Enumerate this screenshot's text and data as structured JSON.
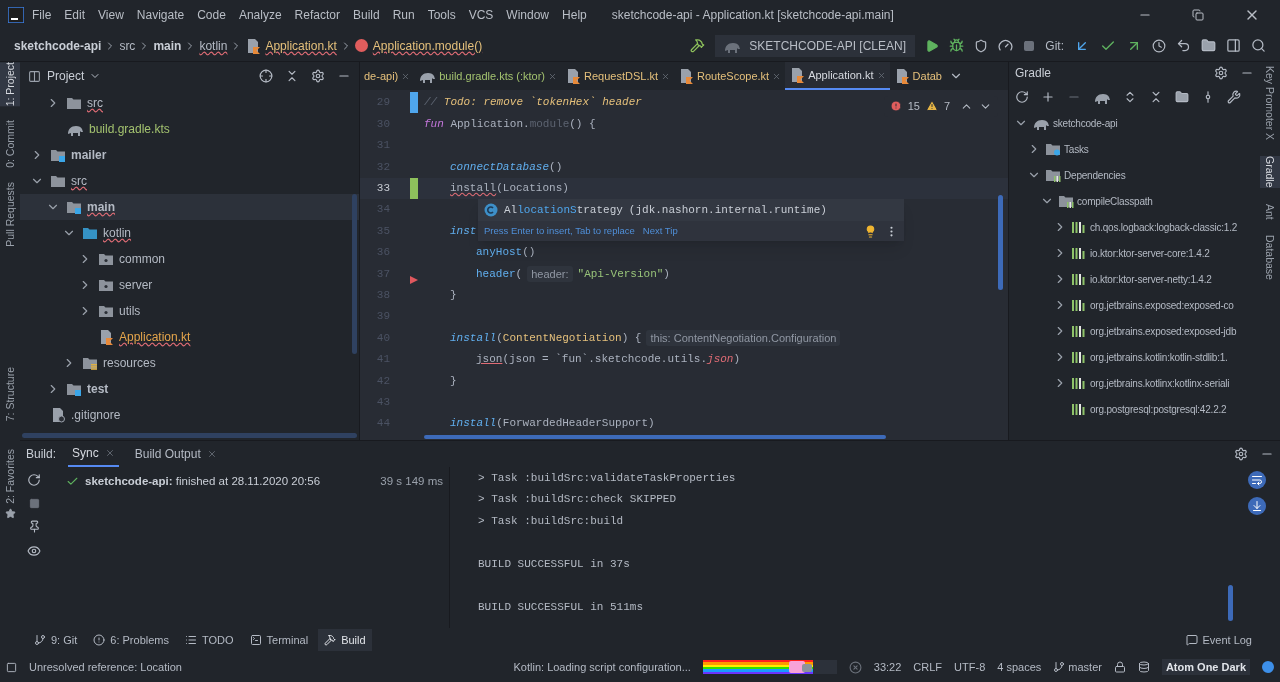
{
  "menu": [
    "File",
    "Edit",
    "View",
    "Navigate",
    "Code",
    "Analyze",
    "Refactor",
    "Build",
    "Run",
    "Tools",
    "VCS",
    "Window",
    "Help"
  ],
  "window": {
    "title": "sketchcode-api - Application.kt [sketchcode-api.main]"
  },
  "breadcrumbs": [
    {
      "label": "sketchcode-api",
      "kind": "project",
      "error": false
    },
    {
      "label": "src",
      "kind": "dir",
      "error": false
    },
    {
      "label": "main",
      "kind": "dir",
      "error": false
    },
    {
      "label": "kotlin",
      "kind": "dir",
      "error": true
    },
    {
      "label": "Application.kt",
      "kind": "file",
      "error": true
    },
    {
      "label": "Application.module()",
      "kind": "function",
      "error": true
    }
  ],
  "run_config": "SKETCHCODE-API [CLEAN]",
  "git_label": "Git:",
  "left_strip": [
    {
      "label": "1: Project",
      "selected": true
    },
    {
      "label": "0: Commit",
      "selected": false
    },
    {
      "label": "Pull Requests",
      "selected": false
    }
  ],
  "left_strip_bottom": [
    {
      "label": "7: Structure",
      "selected": false
    },
    {
      "label": "2: Favorites",
      "selected": false
    }
  ],
  "project": {
    "title": "Project",
    "tree": [
      {
        "children": [
          {
            "label": "src",
            "kind": "folder",
            "expanded": false,
            "error": true,
            "selected": false
          },
          {
            "label": "build.gradle.kts",
            "kind": "gradle",
            "color": "#a3c26f",
            "error": false,
            "selected": false
          }
        ]
      },
      {
        "label": "mailer",
        "kind": "module",
        "expanded": false,
        "error": false,
        "selected": false
      },
      {
        "label": "src",
        "kind": "folder",
        "expanded": true,
        "error": true,
        "selected": false,
        "children": [
          {
            "label": "main",
            "kind": "module",
            "expanded": true,
            "error": true,
            "selected": true,
            "children": [
              {
                "label": "kotlin",
                "kind": "source",
                "expanded": true,
                "error": true,
                "selected": false,
                "children": [
                  {
                    "label": "common",
                    "kind": "package",
                    "expanded": false,
                    "error": false,
                    "selected": false
                  },
                  {
                    "label": "server",
                    "kind": "package",
                    "expanded": false,
                    "error": false,
                    "selected": false
                  },
                  {
                    "label": "utils",
                    "kind": "package",
                    "expanded": false,
                    "error": false,
                    "selected": false
                  },
                  {
                    "label": "Application.kt",
                    "kind": "kotlin",
                    "color": "#e5a54b",
                    "error": true,
                    "selected": false
                  }
                ]
              },
              {
                "label": "resources",
                "kind": "resources",
                "expanded": false,
                "error": false,
                "selected": false
              }
            ]
          },
          {
            "label": "test",
            "kind": "module",
            "expanded": false,
            "error": false,
            "selected": false
          }
        ]
      },
      {
        "label": ".gitignore",
        "kind": "ignore",
        "error": false,
        "selected": false
      }
    ]
  },
  "editor": {
    "tabs": [
      {
        "label": "de-api)",
        "kind": "kotlin",
        "selected": false
      },
      {
        "label": "build.gradle.kts (:ktor)",
        "kind": "gradle",
        "selected": false
      },
      {
        "label": "RequestDSL.kt",
        "kind": "kotlin",
        "selected": false
      },
      {
        "label": "RouteScope.kt",
        "kind": "kotlin",
        "selected": false
      },
      {
        "label": "Application.kt",
        "kind": "kotlin",
        "selected": true
      },
      {
        "label": "Datab",
        "kind": "kotlin",
        "selected": false
      }
    ],
    "errors": "15",
    "warnings": "7",
    "lines": [
      {
        "number": "29",
        "current": false,
        "modified": true,
        "added": false,
        "flagged": false,
        "tokens": [
          {
            "kind": "comment",
            "t": "//"
          },
          {
            "kind": "todo",
            "t": " Todo: remove `tokenHex` header"
          }
        ]
      },
      {
        "number": "30",
        "current": false,
        "modified": false,
        "added": false,
        "flagged": false,
        "tokens": [
          {
            "kind": "keyword",
            "t": "fun"
          },
          {
            "kind": "plain",
            "t": " Application."
          },
          {
            "kind": "muted",
            "t": "module"
          },
          {
            "kind": "plain",
            "t": "() {"
          }
        ],
        "children": [
          {
            "number": "31",
            "current": false,
            "modified": false,
            "added": false,
            "flagged": false
          },
          {
            "number": "32",
            "current": false,
            "modified": false,
            "added": false,
            "flagged": false,
            "tokens": [
              {
                "kind": "call",
                "t": "connectDatabase"
              },
              {
                "kind": "plain",
                "t": "()"
              }
            ]
          },
          {
            "number": "33",
            "current": true,
            "modified": false,
            "added": true,
            "flagged": false,
            "tokens": [
              {
                "kind": "error",
                "t": "install"
              },
              {
                "kind": "plain",
                "t": "(Locations)"
              }
            ]
          },
          {
            "number": "34",
            "current": false,
            "modified": false,
            "added": false,
            "flagged": false
          },
          {
            "number": "35",
            "current": false,
            "modified": false,
            "added": false,
            "flagged": false,
            "tokens": [
              {
                "kind": "call",
                "t": "inst"
              }
            ],
            "children": [
              {
                "number": "36",
                "current": false,
                "modified": false,
                "added": false,
                "flagged": false,
                "tokens": [
                  {
                    "kind": "fn",
                    "t": "anyHost"
                  },
                  {
                    "kind": "plain",
                    "t": "()"
                  }
                ]
              },
              {
                "number": "37",
                "current": false,
                "modified": false,
                "added": false,
                "flagged": true,
                "tokens": [
                  {
                    "kind": "fn",
                    "t": "header"
                  },
                  {
                    "kind": "plain",
                    "t": "("
                  },
                  {
                    "kind": "hint",
                    "t": "header:"
                  },
                  {
                    "kind": "string",
                    "t": "\"Api-Version\""
                  },
                  {
                    "kind": "plain",
                    "t": ")"
                  }
                ]
              }
            ]
          },
          {
            "number": "38",
            "current": false,
            "modified": false,
            "added": false,
            "flagged": false,
            "tokens": [
              {
                "kind": "plain",
                "t": "}"
              }
            ]
          },
          {
            "number": "39",
            "current": false,
            "modified": false,
            "added": false,
            "flagged": false
          },
          {
            "number": "40",
            "current": false,
            "modified": false,
            "added": false,
            "flagged": false,
            "tokens": [
              {
                "kind": "call",
                "t": "install"
              },
              {
                "kind": "plain",
                "t": "("
              },
              {
                "kind": "cls",
                "t": "ContentNegotiation"
              },
              {
                "kind": "plain",
                "t": ") {"
              },
              {
                "kind": "hint",
                "t": "this: ContentNegotiation.Configuration"
              }
            ],
            "children": [
              {
                "number": "41",
                "current": false,
                "modified": false,
                "added": false,
                "flagged": false,
                "tokens": [
                  {
                    "kind": "unresolved",
                    "t": "json"
                  },
                  {
                    "kind": "plain",
                    "t": "(json = `fun`.sketchcode.utils."
                  },
                  {
                    "kind": "prop",
                    "t": "json"
                  },
                  {
                    "kind": "plain",
                    "t": ")"
                  }
                ]
              }
            ]
          },
          {
            "number": "42",
            "current": false,
            "modified": false,
            "added": false,
            "flagged": false,
            "tokens": [
              {
                "kind": "plain",
                "t": "}"
              }
            ]
          },
          {
            "number": "43",
            "current": false,
            "modified": false,
            "added": false,
            "flagged": false
          },
          {
            "number": "44",
            "current": false,
            "modified": false,
            "added": false,
            "flagged": false,
            "tokens": [
              {
                "kind": "call",
                "t": "install"
              },
              {
                "kind": "plain",
                "t": "(ForwardedHeaderSupport)"
              }
            ]
          }
        ]
      }
    ],
    "popup": {
      "parts": [
        {
          "t": "Al",
          "match": false
        },
        {
          "t": "locationS",
          "match": true
        },
        {
          "t": "trategy",
          "match": false
        }
      ],
      "package": "(jdk.nashorn.internal.runtime)",
      "hint": "Press Enter to insert, Tab to replace",
      "link": "Next Tip"
    }
  },
  "gradle": {
    "title": "Gradle",
    "tree": [
      {
        "label": "sketchcode-api",
        "kind": "project",
        "expanded": true,
        "children": [
          {
            "label": "Tasks",
            "kind": "tasks",
            "expanded": false
          },
          {
            "label": "Dependencies",
            "kind": "deps",
            "expanded": true,
            "children": [
              {
                "label": "compileClasspath",
                "kind": "deps",
                "expanded": true,
                "children": [
                  {
                    "label": "ch.qos.logback:logback-classic:1.2",
                    "kind": "library",
                    "expanded": false
                  },
                  {
                    "label": "io.ktor:ktor-server-core:1.4.2",
                    "kind": "library",
                    "expanded": false
                  },
                  {
                    "label": "io.ktor:ktor-server-netty:1.4.2",
                    "kind": "library",
                    "expanded": false
                  },
                  {
                    "label": "org.jetbrains.exposed:exposed-co",
                    "kind": "library",
                    "expanded": false
                  },
                  {
                    "label": "org.jetbrains.exposed:exposed-jdb",
                    "kind": "library",
                    "expanded": false
                  },
                  {
                    "label": "org.jetbrains.kotlin:kotlin-stdlib:1.",
                    "kind": "library",
                    "expanded": false
                  },
                  {
                    "label": "org.jetbrains.kotlinx:kotlinx-seriali",
                    "kind": "library",
                    "expanded": false
                  },
                  {
                    "label": "org.postgresql:postgresql:42.2.2",
                    "kind": "library"
                  }
                ]
              }
            ]
          }
        ]
      }
    ]
  },
  "right_strip": [
    {
      "label": "Key Promoter X",
      "selected": false
    },
    {
      "label": "Gradle",
      "selected": true
    },
    {
      "label": "Ant",
      "selected": false
    },
    {
      "label": "Database",
      "selected": false
    }
  ],
  "build": {
    "label": "Build:",
    "tabs": [
      {
        "label": "Sync",
        "selected": true
      },
      {
        "label": "Build Output",
        "selected": false
      }
    ],
    "sync_row": {
      "text": "**sketchcode-api:** finished at 28.11.2020 20:56",
      "duration": "39 s 149 ms"
    },
    "output": [
      [
        "> Task :buildSrc:validateTaskProperties",
        "> Task :buildSrc:check SKIPPED",
        "> Task :buildSrc:build"
      ],
      [
        "BUILD SUCCESSFUL in 37s"
      ],
      [
        "BUILD SUCCESSFUL in 511ms"
      ]
    ]
  },
  "tool_tabs": [
    {
      "label": "9: Git",
      "kind": "git",
      "selected": false
    },
    {
      "label": "6: Problems",
      "kind": "problems",
      "selected": false
    },
    {
      "label": "TODO",
      "kind": "todo",
      "selected": false
    },
    {
      "label": "Terminal",
      "kind": "terminal",
      "selected": false
    },
    {
      "label": "Build",
      "kind": "build",
      "selected": true
    }
  ],
  "event_log": "Event Log",
  "status": {
    "message": "Unresolved reference: Location",
    "task": "Kotlin: Loading script configuration...",
    "progress": {
      "level": 0.82
    },
    "position": "33:22",
    "line_sep": "CRLF",
    "encoding": "UTF-8",
    "indent": "4 spaces",
    "branch": "master",
    "theme": "Atom One Dark"
  }
}
